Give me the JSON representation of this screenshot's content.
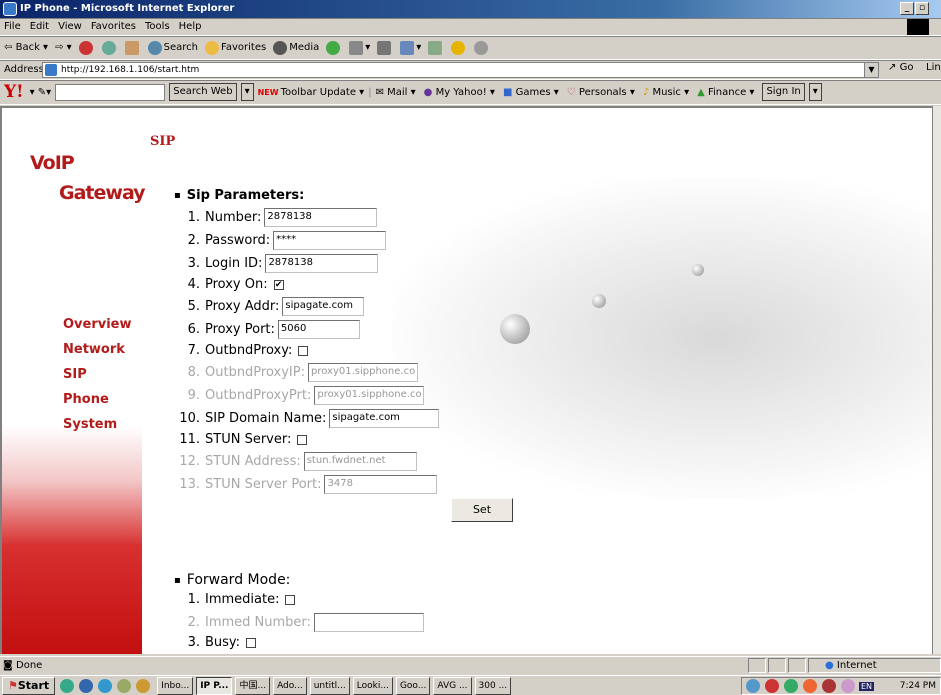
{
  "window": {
    "title": "IP Phone - Microsoft Internet Explorer"
  },
  "menu": [
    "File",
    "Edit",
    "View",
    "Favorites",
    "Tools",
    "Help"
  ],
  "toolbar": {
    "back": "Back",
    "search": "Search",
    "favorites": "Favorites",
    "media": "Media"
  },
  "address": {
    "label": "Address",
    "url": "http://192.168.1.106/start.htm",
    "go": "Go",
    "links": "Link"
  },
  "yahoo": {
    "logo": "Y!",
    "search_btn": "Search Web",
    "items": [
      "Toolbar Update",
      "Mail",
      "My Yahoo!",
      "Games",
      "Personals",
      "Music",
      "Finance"
    ],
    "new_badge": "NEW",
    "sign_in": "Sign In"
  },
  "logo": {
    "line1": "VoIP",
    "line2": "Gateway"
  },
  "nav": [
    "Overview",
    "Network",
    "SIP",
    "Phone",
    "System"
  ],
  "page_title": "SIP",
  "sip": {
    "section": "Sip Parameters:",
    "rows": [
      {
        "n": "1.",
        "label": "Number:",
        "value": "2878138"
      },
      {
        "n": "2.",
        "label": "Password:",
        "value": "****"
      },
      {
        "n": "3.",
        "label": "Login ID:",
        "value": "2878138"
      },
      {
        "n": "4.",
        "label": "Proxy On:",
        "checked": "true"
      },
      {
        "n": "5.",
        "label": "Proxy Addr:",
        "value": "sipagate.com"
      },
      {
        "n": "6.",
        "label": "Proxy Port:",
        "value": "5060"
      },
      {
        "n": "7.",
        "label": "OutbndProxy:",
        "checked": "false"
      },
      {
        "n": "8.",
        "label": "OutbndProxyIP:",
        "value": "proxy01.sipphone.co"
      },
      {
        "n": "9.",
        "label": "OutbndProxyPrt:",
        "value": "proxy01.sipphone.co"
      },
      {
        "n": "10.",
        "label": "SIP Domain Name:",
        "value": "sipagate.com"
      },
      {
        "n": "11.",
        "label": "STUN Server:",
        "checked": "false"
      },
      {
        "n": "12.",
        "label": "STUN Address:",
        "value": "stun.fwdnet.net"
      },
      {
        "n": "13.",
        "label": "STUN Server Port:",
        "value": "3478"
      }
    ],
    "set_button": "Set"
  },
  "forward": {
    "section": "Forward Mode:",
    "rows": [
      {
        "n": "1.",
        "label": "Immediate:"
      },
      {
        "n": "2.",
        "label": "Immed Number:",
        "value": ""
      },
      {
        "n": "3.",
        "label": "Busy:"
      }
    ]
  },
  "status": {
    "text": "Done",
    "zone": "Internet"
  },
  "taskbar": {
    "start": "Start",
    "items": [
      "Inbo...",
      "IP P...",
      "中国...",
      "Ado...",
      "untitl...",
      "Looki...",
      "Goo...",
      "AVG ...",
      "300 ..."
    ],
    "clock": "7:24 PM",
    "lang": "EN"
  },
  "colors": {
    "brand_red": "#b31a1a",
    "titlebar": "#0a246a"
  }
}
